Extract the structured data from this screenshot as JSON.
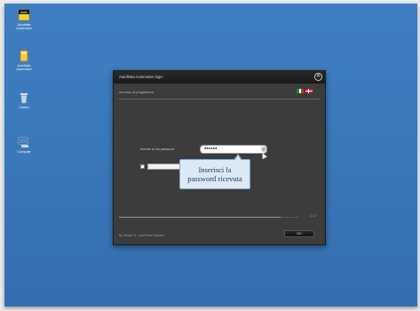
{
  "desktop": {
    "icons": [
      {
        "name": "autoflotta-app-icon",
        "caption": "Autoflotta\nAutomotive",
        "badge": "auto"
      },
      {
        "name": "autoflotta-folder-icon",
        "caption": "Autoflotta\nAutomotive",
        "badge": ""
      },
      {
        "name": "recycle-bin-icon",
        "caption": "Cestino",
        "badge": ""
      },
      {
        "name": "computer-icon",
        "caption": "Computer",
        "badge": ""
      }
    ]
  },
  "dialog": {
    "title": "Autoflotta Automotive login",
    "subheader": "Accesso al programma",
    "languages": [
      "it",
      "en"
    ],
    "close_glyph": "✕",
    "password_label": "Inserire la tua password",
    "password_value": "●●●●●●",
    "remember_label": "",
    "callout_line1": "Inserisci la",
    "callout_line2": "password ricevuta",
    "page_indicator": "1 / 2",
    "progress": 0.9,
    "footer": "By default: 5 - AutoFlotta Software",
    "ok_label": "OK"
  },
  "colors": {
    "desktop": "#3a77b8",
    "dialog_bg": "#3c3c3c",
    "callout_bg": "#dbe9f6"
  }
}
